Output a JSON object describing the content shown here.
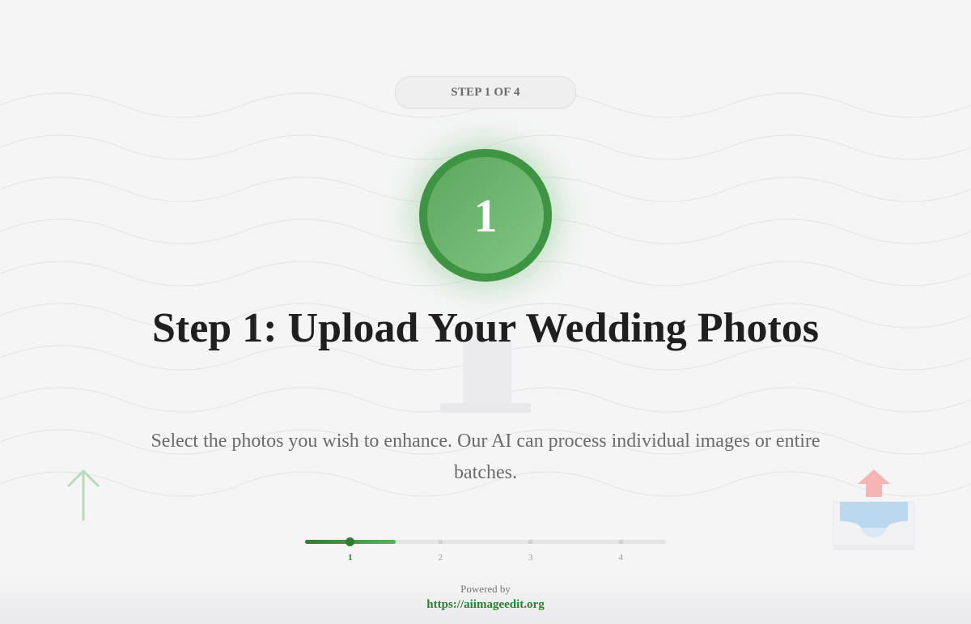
{
  "step_indicator": {
    "label": "STEP 1 OF 4"
  },
  "step_badge": {
    "number": "1"
  },
  "title": "Step 1: Upload Your Wedding Photos",
  "description": "Select the photos you wish to enhance. Our AI can process individual images or entire batches.",
  "progress": {
    "current_step": 1,
    "total_steps": 4,
    "fraction": 0.25,
    "steps": [
      "1",
      "2",
      "3",
      "4"
    ]
  },
  "footer": {
    "powered_by": "Powered by",
    "link_text": "https://aiimageedit.org"
  },
  "colors": {
    "accent": "#2e7d32",
    "accent_light": "#6fb771",
    "background": "#f5f5f6",
    "title_text": "#1f1f1f",
    "body_text": "#6b6b6b"
  },
  "icons": {
    "decor_left": "arrow-up-icon",
    "decor_right": "upload-tray-icon"
  }
}
